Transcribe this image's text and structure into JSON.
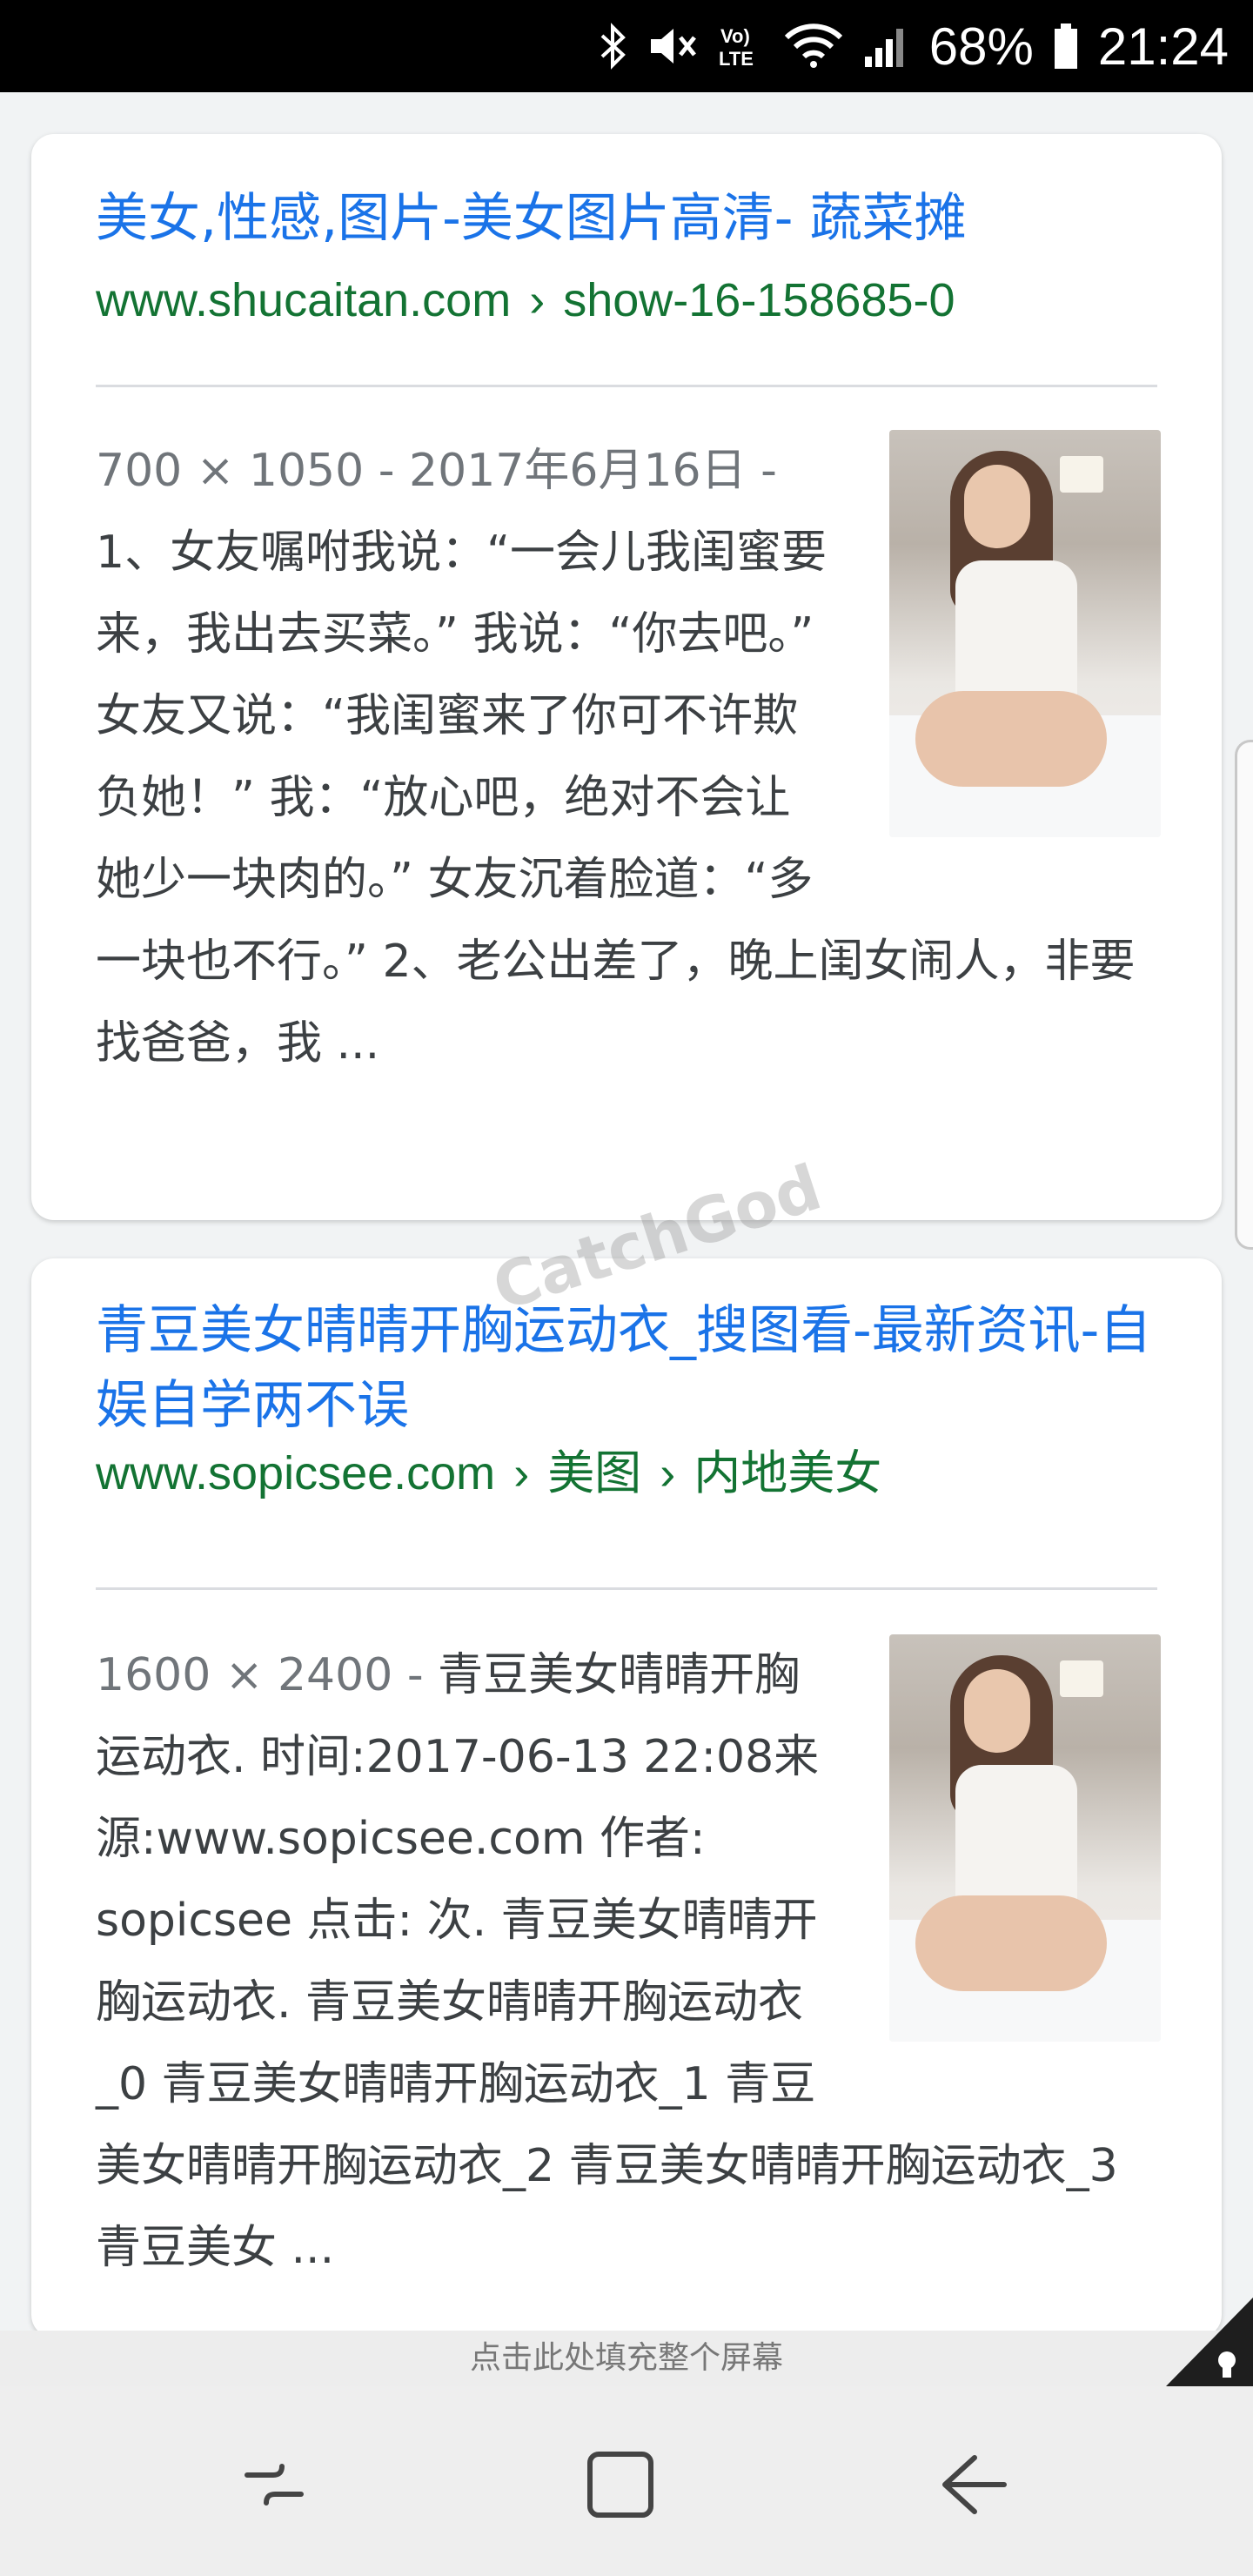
{
  "status_bar": {
    "battery": "68%",
    "time": "21:24",
    "icons": [
      "bluetooth-icon",
      "mute-icon",
      "volte-icon",
      "wifi-icon",
      "signal-icon",
      "battery-icon"
    ],
    "volte_label": "Vo) LTE"
  },
  "results": [
    {
      "title": "美女,性感,图片-美女图片高清- 蔬菜摊",
      "url": "www.shucaitan.com",
      "url_path": [
        "show-16-158685-0"
      ],
      "meta": "700 × 1050 - 2017年6月16日 - ",
      "snippet": "1、女友嘱咐我说：“一会儿我闺蜜要来，我出去买菜。” 我说：“你去吧。” 女友又说：“我闺蜜来了你可不许欺负她！” 我：“放心吧，绝对不会让她少一块肉的。” 女友沉着脸道：“多一块也不行。” 2、老公出差了，晚上闺女闹人，非要找爸爸，我 ..."
    },
    {
      "title": "青豆美女晴晴开胸运动衣_搜图看-最新资讯-自娱自学两不误",
      "url": "www.sopicsee.com",
      "url_path": [
        "美图",
        "内地美女"
      ],
      "meta": "1600 × 2400 - ",
      "snippet": "青豆美女晴晴开胸运动衣. 时间:2017-06-13 22:08来源:www.sopicsee.com 作者: sopicsee 点击: 次. 青豆美女晴晴开胸运动衣. 青豆美女晴晴开胸运动衣_0 青豆美女晴晴开胸运动衣_1 青豆美女晴晴开胸运动衣_2 青豆美女晴晴开胸运动衣_3 青豆美女 ..."
    }
  ],
  "fill_prompt": "点击此处填充整个屏幕",
  "watermark": "CatchGod",
  "nav": {
    "recent_icon": "recent-apps-icon",
    "home_icon": "home-icon",
    "back_icon": "back-icon"
  }
}
